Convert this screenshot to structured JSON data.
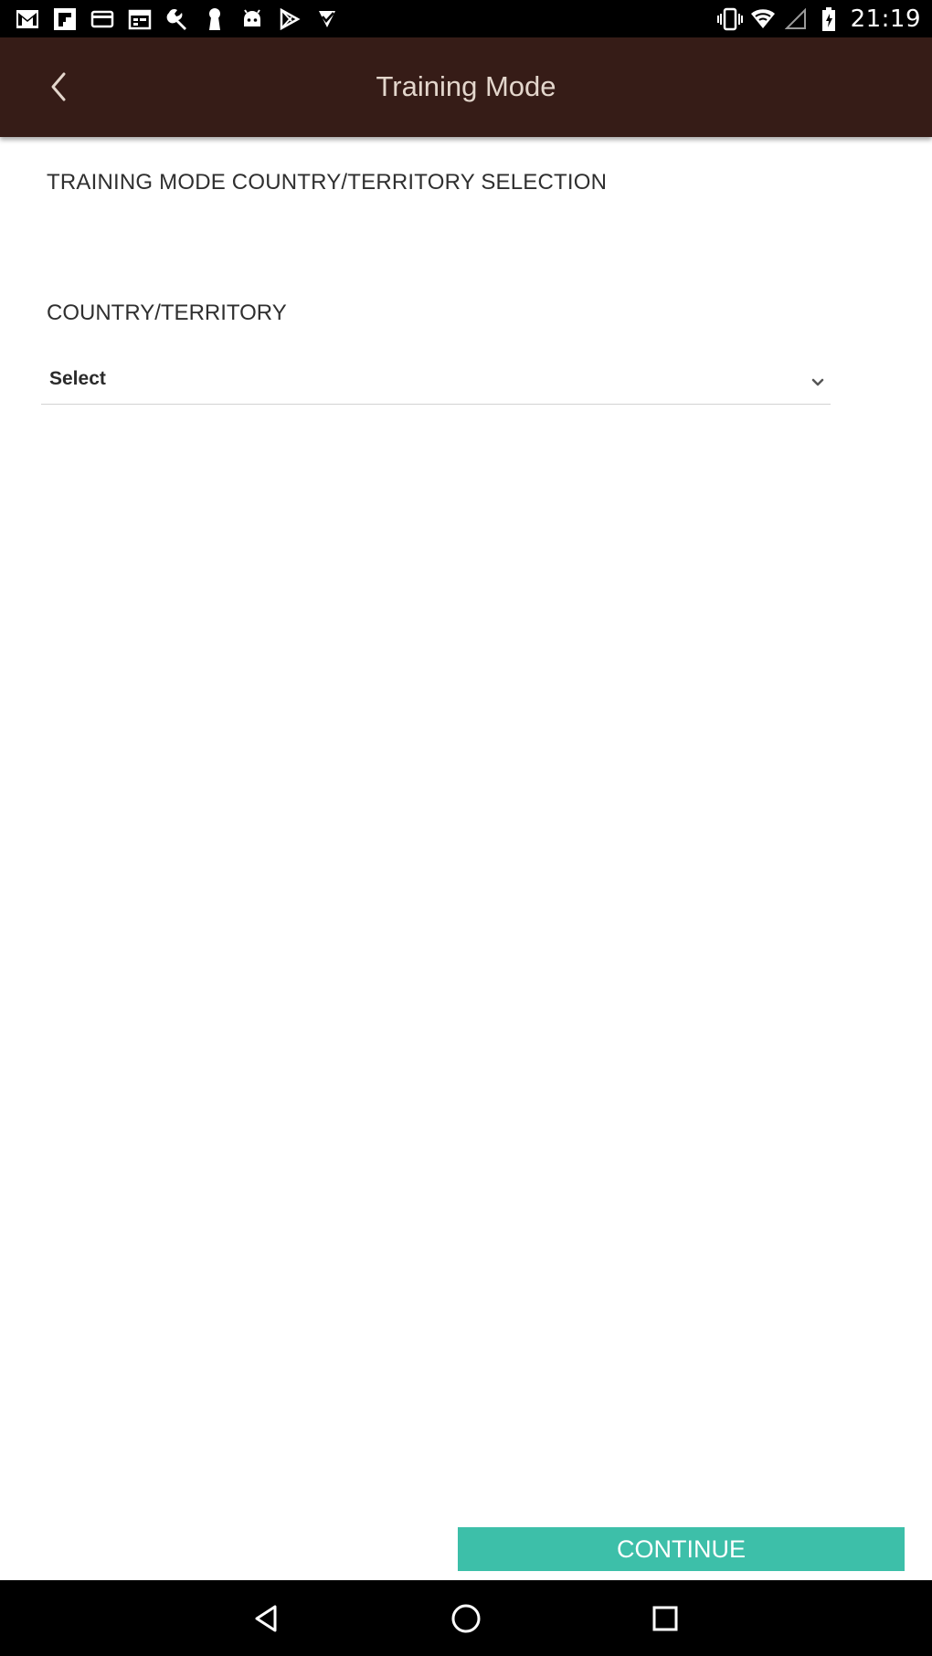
{
  "status_bar": {
    "time": "21:19",
    "left_icons": [
      "gmail-icon",
      "flipboard-icon",
      "card-icon",
      "calendar-icon",
      "wrench-icon",
      "keyhole-icon",
      "android-icon",
      "play-store-icon",
      "checkmark-app-icon"
    ],
    "right_icons": [
      "vibrate-icon",
      "wifi-icon",
      "signal-icon",
      "battery-icon"
    ]
  },
  "app_bar": {
    "title": "Training Mode",
    "back_icon": "chevron-left-icon",
    "background_color": "#361c17"
  },
  "content": {
    "section_title": "TRAINING MODE COUNTRY/TERRITORY SELECTION",
    "country_field": {
      "label": "COUNTRY/TERRITORY",
      "selected_value": "Select",
      "dropdown_icon": "chevron-down-icon"
    }
  },
  "continue_button": {
    "label": "CONTINUE",
    "color": "#3dbfa9"
  },
  "nav_bar": {
    "icons": [
      "back-triangle-icon",
      "home-circle-icon",
      "recents-square-icon"
    ]
  }
}
